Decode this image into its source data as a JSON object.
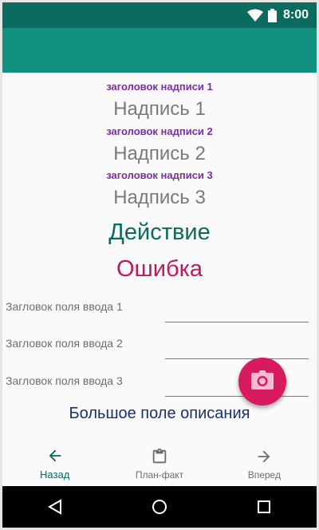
{
  "status_bar": {
    "time": "8:00",
    "icons": [
      "wifi-icon",
      "battery-icon"
    ]
  },
  "app_bar": {},
  "captions": [
    {
      "title": "заголовок надписи 1",
      "text": "Надпись 1"
    },
    {
      "title": "заголовок надписи 2",
      "text": "Надпись 2"
    },
    {
      "title": "заголовок надписи 3",
      "text": "Надпись 3"
    }
  ],
  "action_text": "Действие",
  "error_text": "Ошибка",
  "fields": [
    {
      "label": "Загловок поля ввода 1",
      "value": ""
    },
    {
      "label": "Загловок поля ввода 2",
      "value": ""
    },
    {
      "label": "Загловок поля ввода 3",
      "value": ""
    }
  ],
  "big_field": {
    "label": "Большое поле описания"
  },
  "fab": {
    "icon": "camera-icon"
  },
  "bottom_nav": {
    "items": [
      {
        "label": "Назад",
        "icon": "arrow-left-icon",
        "active": true
      },
      {
        "label": "План-факт",
        "icon": "clipboard-icon",
        "active": false
      },
      {
        "label": "Вперед",
        "icon": "arrow-right-icon",
        "active": false
      }
    ]
  },
  "system_nav": {
    "icons": [
      "back-triangle-icon",
      "home-circle-icon",
      "recents-square-icon"
    ]
  },
  "colors": {
    "status_bar": "#0b6b5f",
    "app_bar": "#118f7f",
    "caption_title": "#7b2ea3",
    "action": "#0b6b5f",
    "error": "#c2185b",
    "fab": "#d81b60"
  }
}
